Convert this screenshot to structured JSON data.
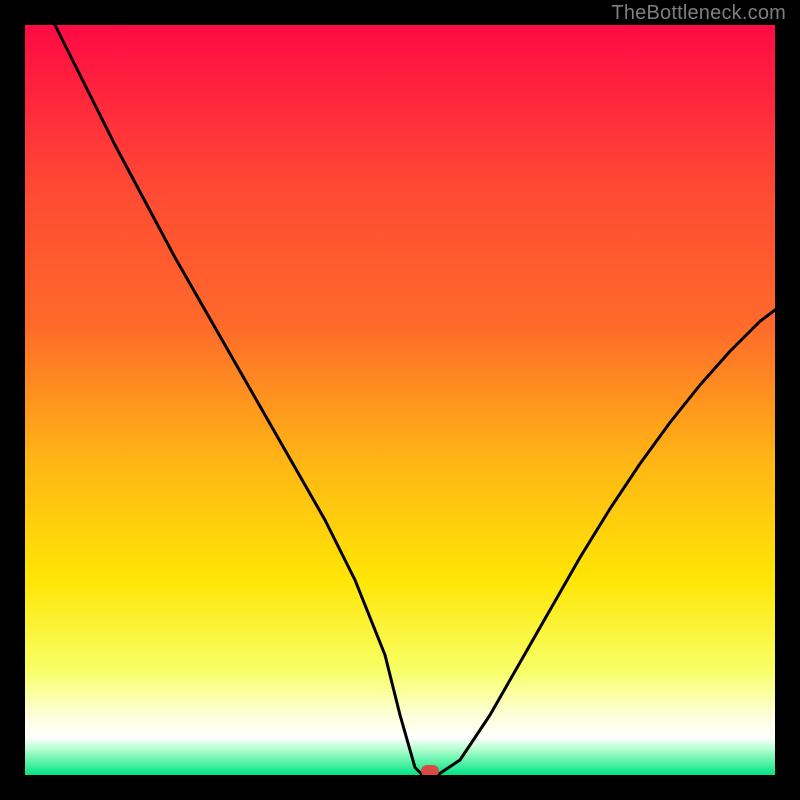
{
  "watermark": "TheBottleneck.com",
  "chart_data": {
    "type": "line",
    "title": "",
    "xlabel": "",
    "ylabel": "",
    "xlim": [
      0,
      100
    ],
    "ylim": [
      0,
      100
    ],
    "grid": false,
    "background_gradient": {
      "top_color": "#ff0a45",
      "upper_mid_color": "#ff6a2a",
      "mid_color": "#ffb515",
      "lower_mid_color": "#ffe605",
      "near_bottom_color": "#f8ff66",
      "pale_band_color": "#fdffd8",
      "bottom_color": "#00e583"
    },
    "series": [
      {
        "name": "bottleneck-curve",
        "x": [
          4,
          8,
          12,
          16,
          20,
          24,
          28,
          32,
          36,
          40,
          44,
          48,
          50,
          52,
          53,
          55,
          58,
          62,
          66,
          70,
          74,
          78,
          82,
          86,
          90,
          94,
          98,
          100
        ],
        "y": [
          100,
          92,
          84,
          76.5,
          69,
          62,
          55,
          48,
          41,
          34,
          26,
          16,
          8,
          1,
          0,
          0,
          2,
          8,
          15,
          22,
          29,
          35.5,
          41.5,
          47,
          52,
          56.5,
          60.5,
          62
        ]
      }
    ],
    "marker": {
      "name": "optimal-point",
      "x": 54,
      "y": 0,
      "color": "#d84a44",
      "shape": "rounded-pill"
    }
  }
}
